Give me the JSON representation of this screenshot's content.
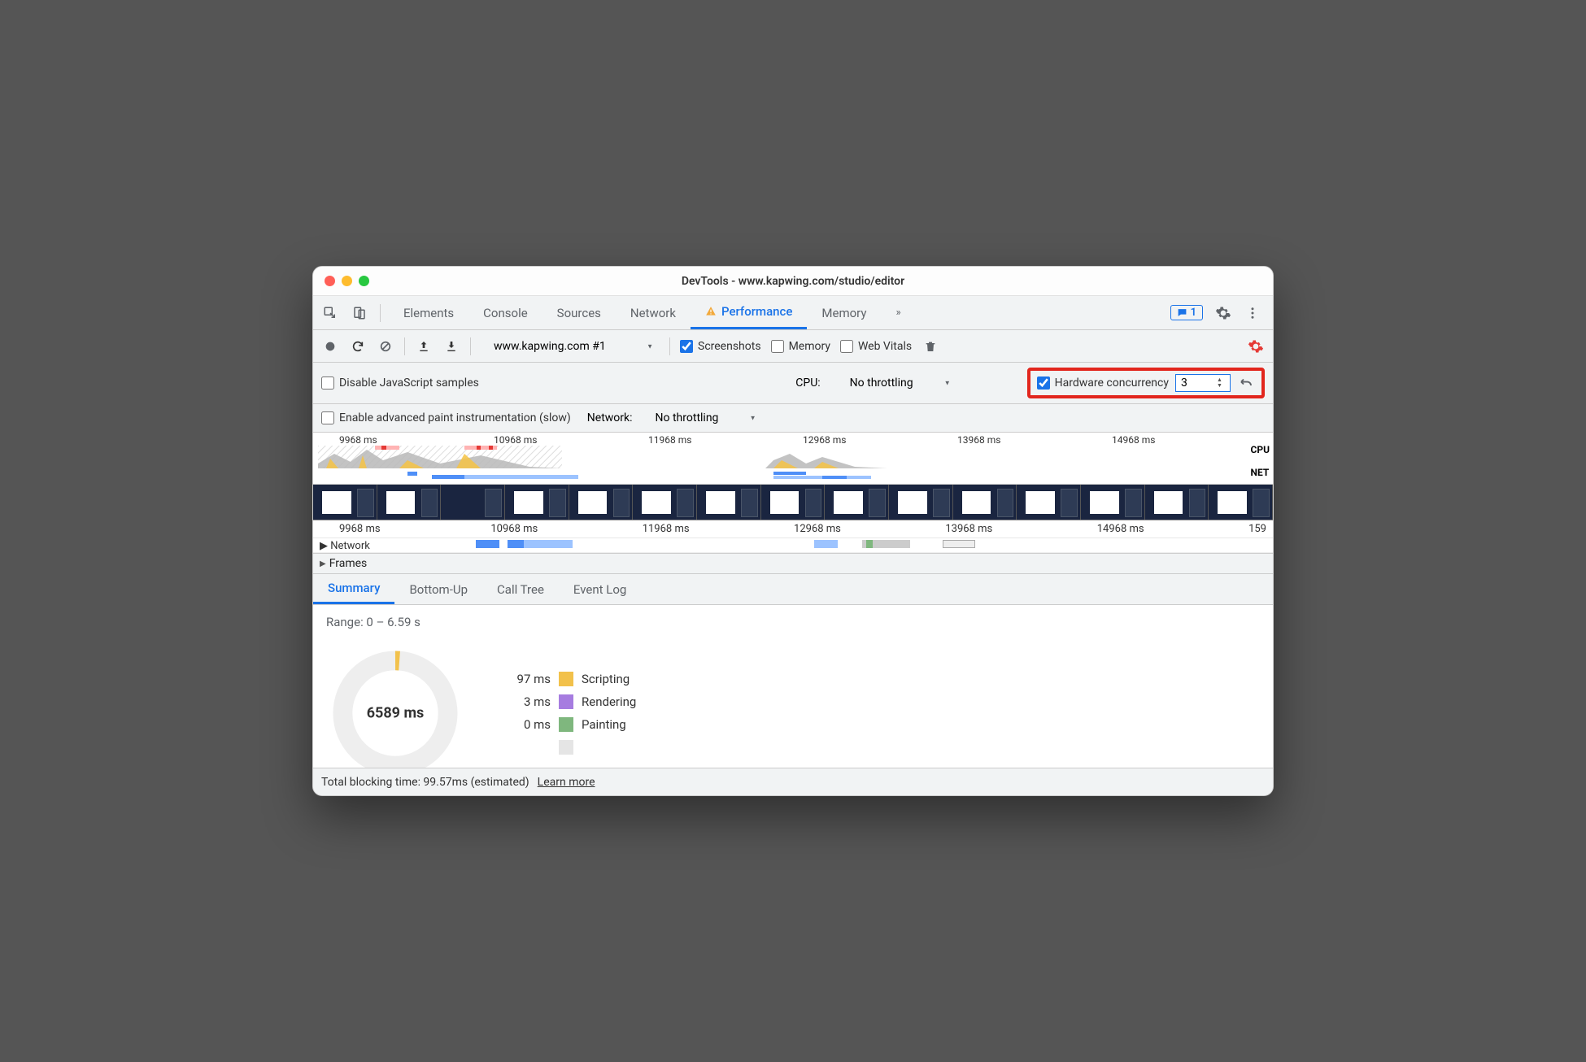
{
  "window": {
    "title": "DevTools - www.kapwing.com/studio/editor"
  },
  "tabs": {
    "items": [
      "Elements",
      "Console",
      "Sources",
      "Network",
      "Performance",
      "Memory"
    ],
    "active": "Performance",
    "message_count": "1"
  },
  "toolbar": {
    "target": "www.kapwing.com #1",
    "screenshots_label": "Screenshots",
    "memory_label": "Memory",
    "webvitals_label": "Web Vitals"
  },
  "settings1": {
    "disable_js_label": "Disable JavaScript samples",
    "cpu_label": "CPU:",
    "cpu_value": "No throttling",
    "hw_label": "Hardware concurrency",
    "hw_value": "3"
  },
  "settings2": {
    "paint_label": "Enable advanced paint instrumentation (slow)",
    "net_label": "Network:",
    "net_value": "No throttling"
  },
  "overview": {
    "ticks": [
      "9968 ms",
      "10968 ms",
      "11968 ms",
      "12968 ms",
      "13968 ms",
      "14968 ms"
    ],
    "cpu_label": "CPU",
    "net_label": "NET"
  },
  "detail": {
    "ticks": [
      "9968 ms",
      "10968 ms",
      "11968 ms",
      "12968 ms",
      "13968 ms",
      "14968 ms"
    ],
    "ticks_last": "159",
    "network_cut": "Network",
    "frames_label": "Frames"
  },
  "subtabs": {
    "items": [
      "Summary",
      "Bottom-Up",
      "Call Tree",
      "Event Log"
    ],
    "active": "Summary"
  },
  "summary": {
    "range": "Range: 0 – 6.59 s",
    "center": "6589 ms",
    "legend": [
      {
        "val": "97 ms",
        "label": "Scripting"
      },
      {
        "val": "3 ms",
        "label": "Rendering"
      },
      {
        "val": "0 ms",
        "label": "Painting"
      }
    ]
  },
  "footer": {
    "tbt": "Total blocking time: 99.57ms (estimated)",
    "learn": "Learn more"
  }
}
